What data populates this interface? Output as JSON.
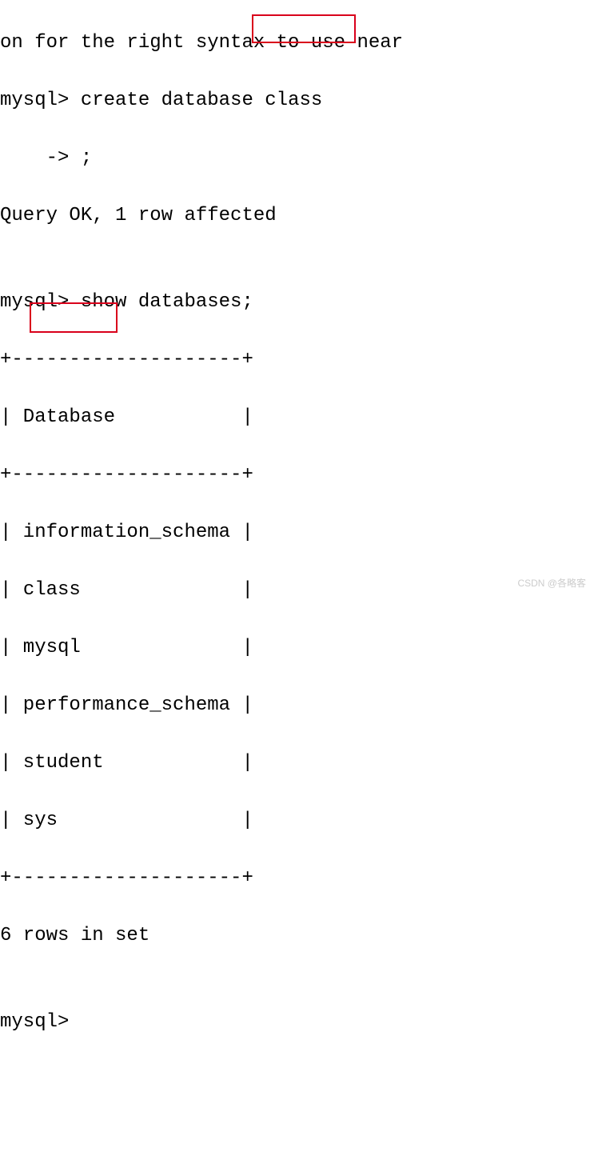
{
  "terminal": {
    "line0": "on for the right syntax to use near",
    "prompt1": "mysql> ",
    "cmd1_part1": "create database ",
    "cmd1_keyword": "class",
    "prompt2": "    -> ",
    "cmd1_terminator": ";",
    "result1": "Query OK, 1 row affected",
    "blank": "",
    "prompt3": "mysql> ",
    "cmd2": "show databases;",
    "table_border": "+--------------------+",
    "table_header": "| Database           |",
    "rows": {
      "r1": "| information_schema |",
      "r2_prefix": "| ",
      "r2_keyword": "class",
      "r2_suffix": "              |",
      "r3": "| mysql              |",
      "r4": "| performance_schema |",
      "r5": "| student            |",
      "r6": "| sys                |"
    },
    "result2": "6 rows in set",
    "prompt4": "mysql> "
  },
  "watermark": "CSDN @各略客"
}
